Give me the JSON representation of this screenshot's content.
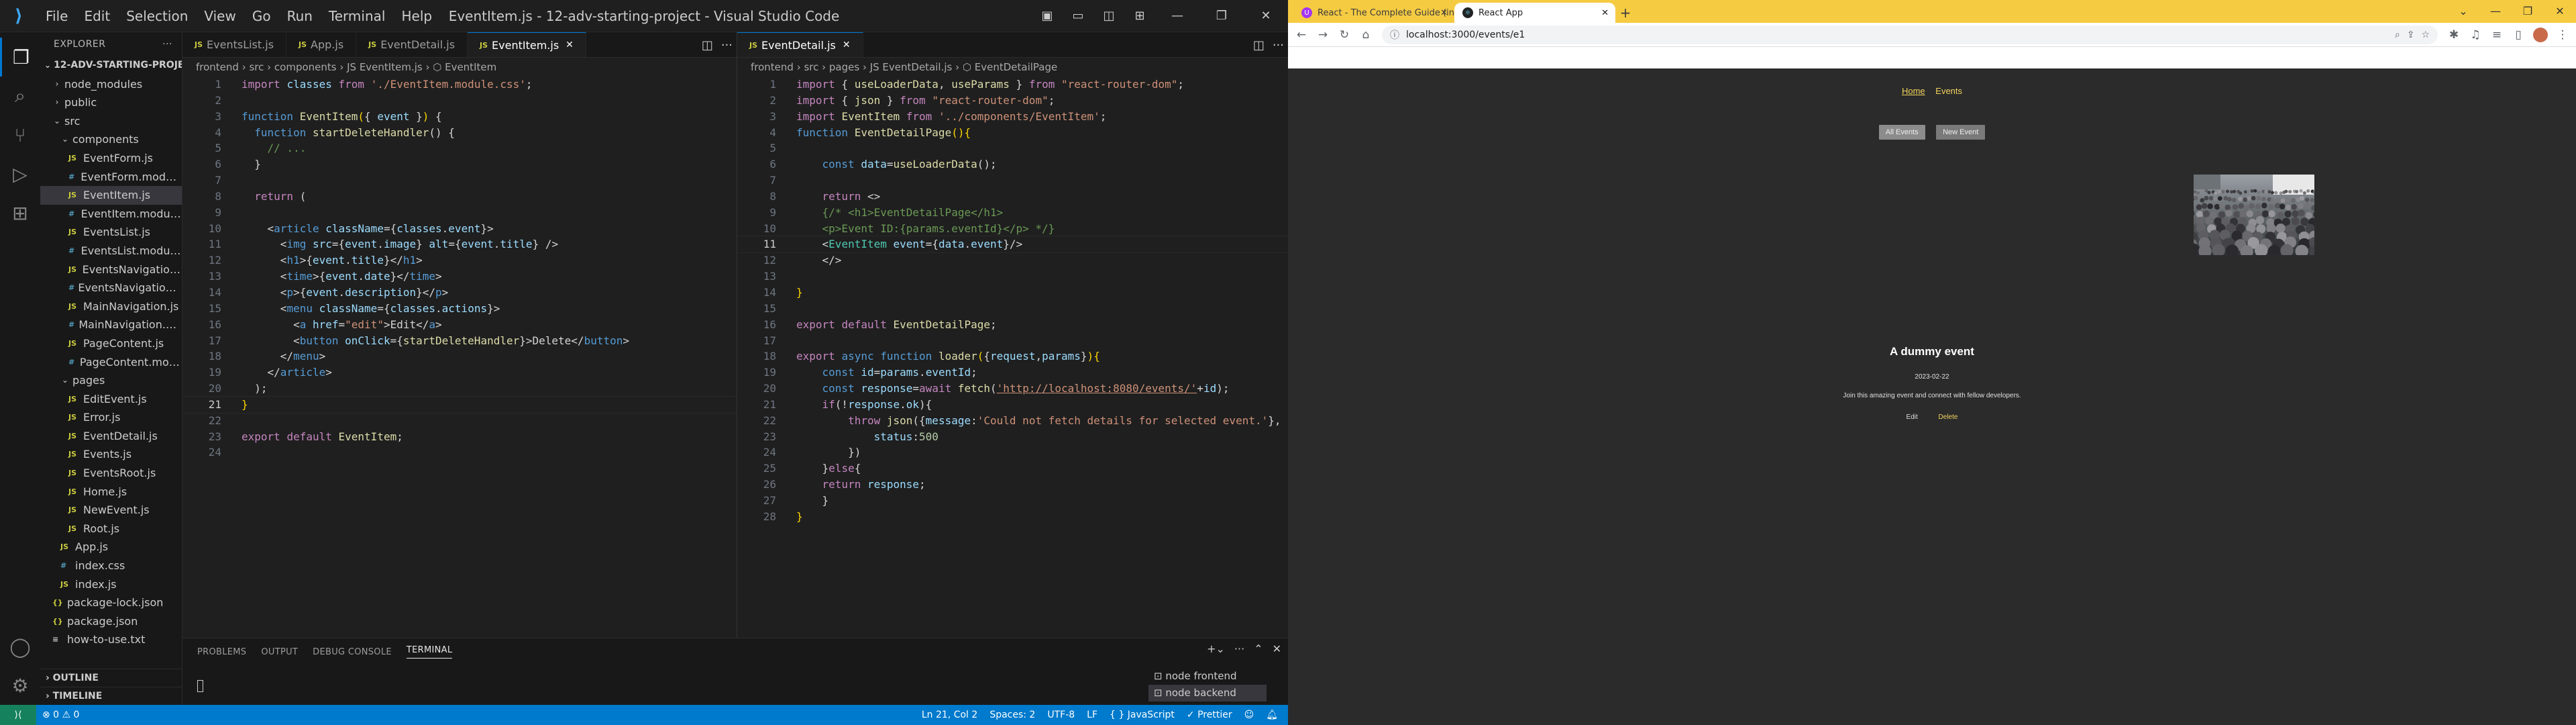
{
  "vscode": {
    "menu": [
      "File",
      "Edit",
      "Selection",
      "View",
      "Go",
      "Run",
      "Terminal",
      "Help"
    ],
    "window_title": "EventItem.js - 12-adv-starting-project - Visual Studio Code",
    "explorer": {
      "header": "EXPLORER",
      "project": "12-ADV-STARTING-PROJE...",
      "tree": [
        {
          "label": "node_modules",
          "type": "folder",
          "depth": 1,
          "open": false
        },
        {
          "label": "public",
          "type": "folder",
          "depth": 1,
          "open": false
        },
        {
          "label": "src",
          "type": "folder",
          "depth": 1,
          "open": true
        },
        {
          "label": "components",
          "type": "folder",
          "depth": 2,
          "open": true
        },
        {
          "label": "EventForm.js",
          "type": "js",
          "depth": 3
        },
        {
          "label": "EventForm.module.css",
          "type": "css",
          "depth": 3
        },
        {
          "label": "EventItem.js",
          "type": "js",
          "depth": 3,
          "selected": true
        },
        {
          "label": "EventItem.module.css",
          "type": "css",
          "depth": 3
        },
        {
          "label": "EventsList.js",
          "type": "js",
          "depth": 3
        },
        {
          "label": "EventsList.module.css",
          "type": "css",
          "depth": 3
        },
        {
          "label": "EventsNavigation.js",
          "type": "js",
          "depth": 3
        },
        {
          "label": "EventsNavigation.module.css",
          "type": "css",
          "depth": 3
        },
        {
          "label": "MainNavigation.js",
          "type": "js",
          "depth": 3
        },
        {
          "label": "MainNavigation.module.css",
          "type": "css",
          "depth": 3
        },
        {
          "label": "PageContent.js",
          "type": "js",
          "depth": 3
        },
        {
          "label": "PageContent.module.css",
          "type": "css",
          "depth": 3
        },
        {
          "label": "pages",
          "type": "folder",
          "depth": 2,
          "open": true
        },
        {
          "label": "EditEvent.js",
          "type": "js",
          "depth": 3
        },
        {
          "label": "Error.js",
          "type": "js",
          "depth": 3
        },
        {
          "label": "EventDetail.js",
          "type": "js",
          "depth": 3
        },
        {
          "label": "Events.js",
          "type": "js",
          "depth": 3
        },
        {
          "label": "EventsRoot.js",
          "type": "js",
          "depth": 3
        },
        {
          "label": "Home.js",
          "type": "js",
          "depth": 3
        },
        {
          "label": "NewEvent.js",
          "type": "js",
          "depth": 3
        },
        {
          "label": "Root.js",
          "type": "js",
          "depth": 3
        },
        {
          "label": "App.js",
          "type": "js",
          "depth": 2
        },
        {
          "label": "index.css",
          "type": "css",
          "depth": 2
        },
        {
          "label": "index.js",
          "type": "js",
          "depth": 2
        },
        {
          "label": "package-lock.json",
          "type": "json",
          "depth": 1
        },
        {
          "label": "package.json",
          "type": "json",
          "depth": 1
        },
        {
          "label": "how-to-use.txt",
          "type": "txt",
          "depth": 1
        }
      ],
      "outline": "OUTLINE",
      "timeline": "TIMELINE"
    },
    "group1": {
      "tabs": [
        {
          "label": "EventsList.js",
          "active": false
        },
        {
          "label": "App.js",
          "active": false
        },
        {
          "label": "EventDetail.js",
          "active": false
        },
        {
          "label": "EventItem.js",
          "active": true
        }
      ],
      "breadcrumb": "frontend  ›  src  ›  components  ›  JS EventItem.js  ›  ⬡ EventItem",
      "current_line": 21
    },
    "group2": {
      "tabs": [
        {
          "label": "EventDetail.js",
          "active": true
        }
      ],
      "breadcrumb": "frontend  ›  src  ›  pages  ›  JS EventDetail.js  ›  ⬡ EventDetailPage",
      "current_line": 11
    },
    "panel": {
      "tabs": [
        "PROBLEMS",
        "OUTPUT",
        "DEBUG CONSOLE",
        "TERMINAL"
      ],
      "active_tab": "TERMINAL",
      "terminals": [
        "node  frontend",
        "node  backend"
      ]
    },
    "status": {
      "problems": "⊗ 0  ⚠ 0",
      "position": "Ln 21, Col 2",
      "spaces": "Spaces: 2",
      "encoding": "UTF-8",
      "eol": "LF",
      "language": "{ } JavaScript",
      "formatter": "✓ Prettier"
    }
  },
  "chrome": {
    "tabs": [
      {
        "label": "React - The Complete Guide (incl...",
        "active": false
      },
      {
        "label": "React App",
        "active": true
      }
    ],
    "url": "localhost:3000/events/e1",
    "page": {
      "nav": [
        "Home",
        "Events"
      ],
      "buttons": [
        "All Events",
        "New Event"
      ],
      "event_title": "A dummy event",
      "event_date": "2023-02-22",
      "event_description": "Join this amazing event and connect with fellow developers.",
      "actions": [
        "Edit",
        "Delete"
      ],
      "image_alt": "A dummy event"
    }
  }
}
